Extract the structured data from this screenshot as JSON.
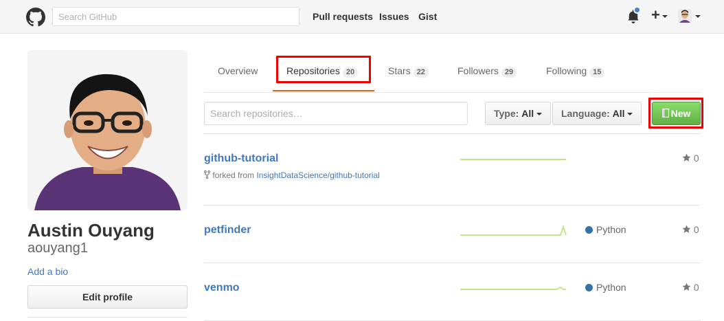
{
  "header": {
    "search_placeholder": "Search GitHub",
    "nav": [
      "Pull requests",
      "Issues",
      "Gist"
    ],
    "plus_symbol": "+",
    "notification_color": "#4183c4"
  },
  "profile": {
    "full_name": "Austin Ouyang",
    "username": "aouyang1",
    "add_bio_label": "Add a bio",
    "edit_profile_label": "Edit profile"
  },
  "tabs": [
    {
      "label": "Overview",
      "count": null
    },
    {
      "label": "Repositories",
      "count": "20"
    },
    {
      "label": "Stars",
      "count": "22"
    },
    {
      "label": "Followers",
      "count": "29"
    },
    {
      "label": "Following",
      "count": "15"
    }
  ],
  "filters": {
    "search_placeholder": "Search repositories…",
    "type_label": "Type:",
    "type_value": "All",
    "language_label": "Language:",
    "language_value": "All",
    "new_label": "New"
  },
  "repos": [
    {
      "name": "github-tutorial",
      "forked_prefix": "forked from",
      "forked_source": "InsightDataScience/github-tutorial",
      "language": "",
      "stars": "0"
    },
    {
      "name": "petfinder",
      "language": "Python",
      "stars": "0"
    },
    {
      "name": "venmo",
      "language": "Python",
      "stars": "0"
    }
  ],
  "colors": {
    "accent_link": "#4078c0",
    "new_button": "#60b044",
    "highlight_box": "#e00000",
    "active_tab_underline": "#d26911",
    "python_dot": "#3572a5"
  }
}
